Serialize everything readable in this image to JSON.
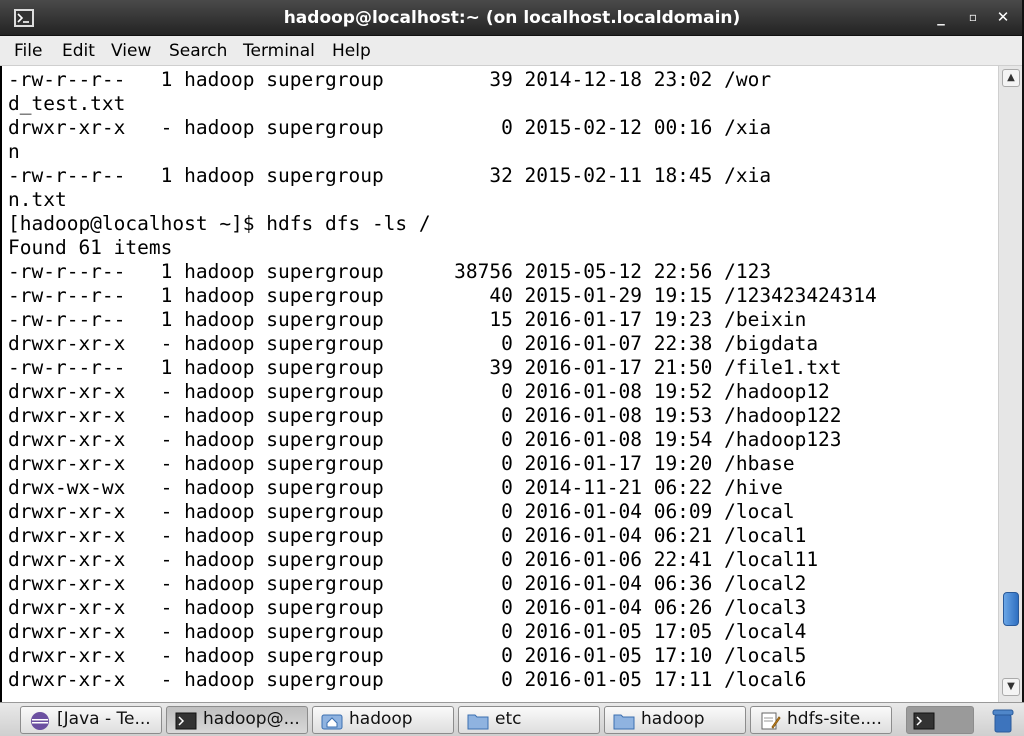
{
  "window": {
    "title": "hadoop@localhost:~ (on localhost.localdomain)",
    "controls": [
      "_",
      "▫",
      "✕"
    ]
  },
  "menu": [
    {
      "label": "File"
    },
    {
      "label": "Edit"
    },
    {
      "label": "View"
    },
    {
      "label": "Search"
    },
    {
      "label": "Terminal"
    },
    {
      "label": "Help"
    }
  ],
  "terminal": {
    "lines": [
      "-rw-r--r--   1 hadoop supergroup         39 2014-12-18 23:02 /wor",
      "d_test.txt",
      "drwxr-xr-x   - hadoop supergroup          0 2015-02-12 00:16 /xia",
      "n",
      "-rw-r--r--   1 hadoop supergroup         32 2015-02-11 18:45 /xia",
      "n.txt",
      "[hadoop@localhost ~]$ hdfs dfs -ls /",
      "Found 61 items",
      "-rw-r--r--   1 hadoop supergroup      38756 2015-05-12 22:56 /123",
      "-rw-r--r--   1 hadoop supergroup         40 2015-01-29 19:15 /123423424314",
      "-rw-r--r--   1 hadoop supergroup         15 2016-01-17 19:23 /beixin",
      "drwxr-xr-x   - hadoop supergroup          0 2016-01-07 22:38 /bigdata",
      "-rw-r--r--   1 hadoop supergroup         39 2016-01-17 21:50 /file1.txt",
      "drwxr-xr-x   - hadoop supergroup          0 2016-01-08 19:52 /hadoop12",
      "drwxr-xr-x   - hadoop supergroup          0 2016-01-08 19:53 /hadoop122",
      "drwxr-xr-x   - hadoop supergroup          0 2016-01-08 19:54 /hadoop123",
      "drwxr-xr-x   - hadoop supergroup          0 2016-01-17 19:20 /hbase",
      "drwx-wx-wx   - hadoop supergroup          0 2014-11-21 06:22 /hive",
      "drwxr-xr-x   - hadoop supergroup          0 2016-01-04 06:09 /local",
      "drwxr-xr-x   - hadoop supergroup          0 2016-01-04 06:21 /local1",
      "drwxr-xr-x   - hadoop supergroup          0 2016-01-06 22:41 /local11",
      "drwxr-xr-x   - hadoop supergroup          0 2016-01-04 06:36 /local2",
      "drwxr-xr-x   - hadoop supergroup          0 2016-01-04 06:26 /local3",
      "drwxr-xr-x   - hadoop supergroup          0 2016-01-05 17:05 /local4",
      "drwxr-xr-x   - hadoop supergroup          0 2016-01-05 17:10 /local5",
      "drwxr-xr-x   - hadoop supergroup          0 2016-01-05 17:11 /local6"
    ]
  },
  "taskbar": {
    "tasks": [
      {
        "label": "[Java - Te...",
        "icon": "eclipse-icon",
        "active": false
      },
      {
        "label": "hadoop@...",
        "icon": "terminal-icon",
        "active": true
      },
      {
        "label": "hadoop",
        "icon": "home-folder-icon",
        "active": false
      },
      {
        "label": "etc",
        "icon": "folder-icon",
        "active": false
      },
      {
        "label": "hadoop",
        "icon": "folder-icon",
        "active": false
      },
      {
        "label": "hdfs-site....",
        "icon": "text-editor-icon",
        "active": false
      }
    ]
  },
  "colors": {
    "titlebar": "#2d2d2d",
    "terminal_bg": "#ffffff",
    "terminal_fg": "#000000",
    "scrollbar_thumb": "#3d7fd1"
  }
}
